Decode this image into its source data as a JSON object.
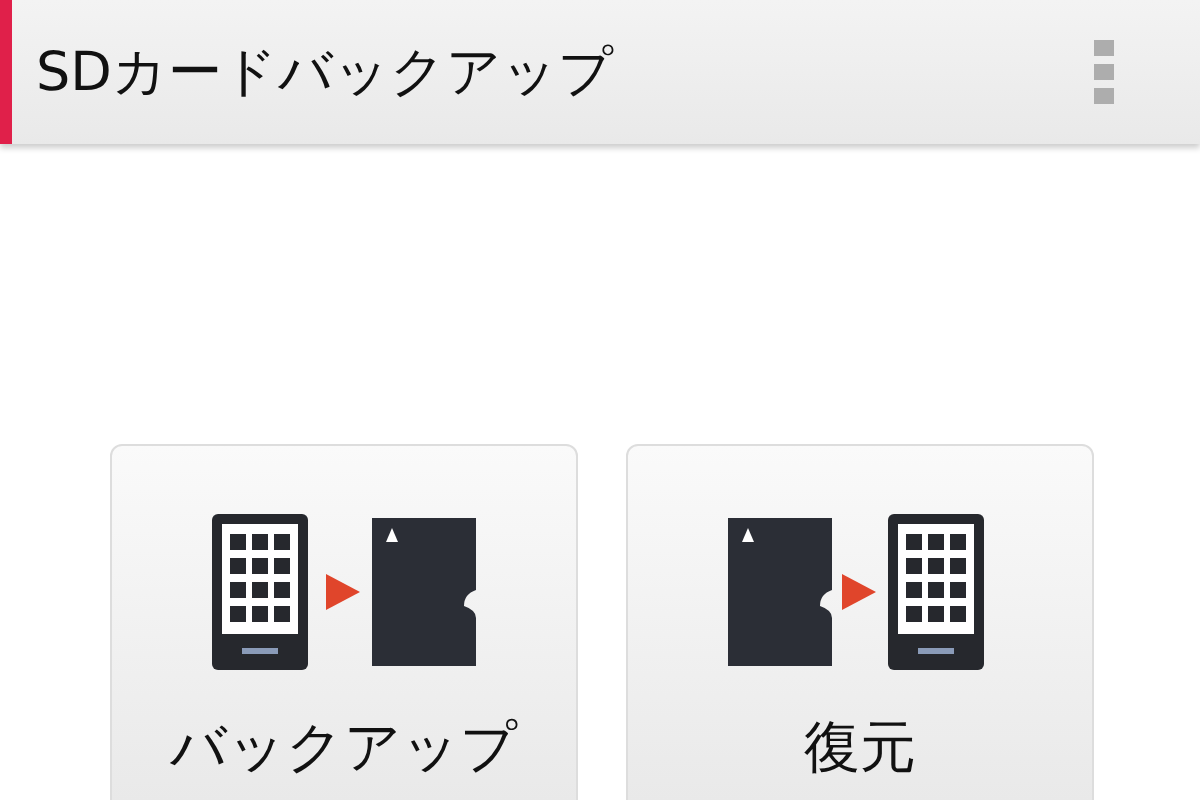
{
  "app_bar": {
    "title": "SDカードバックアップ"
  },
  "actions": [
    {
      "kind": "backup",
      "label": "バックアップ"
    },
    {
      "kind": "restore",
      "label": "復元"
    }
  ]
}
